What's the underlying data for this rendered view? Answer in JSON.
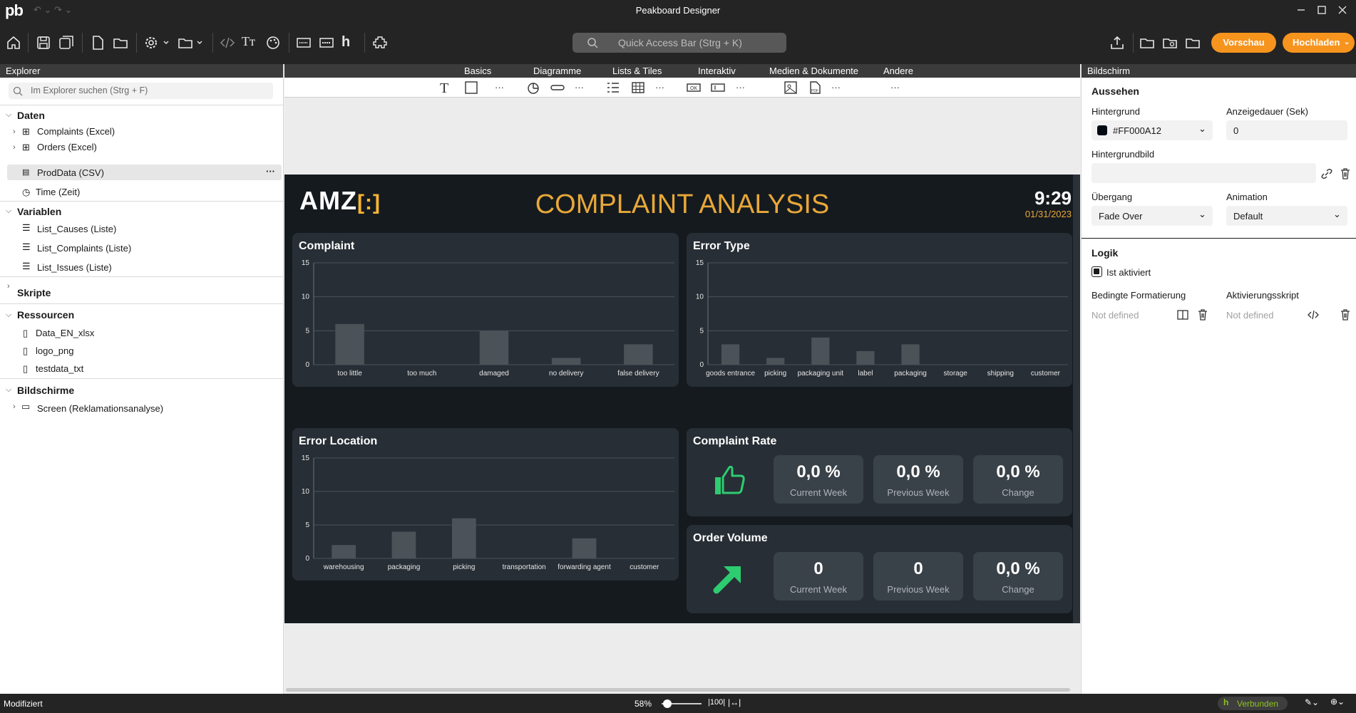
{
  "window": {
    "app_title": "Peakboard Designer",
    "logo": "pb"
  },
  "toolbar": {
    "quick_access_placeholder": "Quick Access Bar (Strg + K)",
    "preview_label": "Vorschau",
    "upload_label": "Hochladen"
  },
  "explorer": {
    "header": "Explorer",
    "search_placeholder": "Im Explorer suchen (Strg + F)",
    "sections": {
      "data": "Daten",
      "variables": "Variablen",
      "scripts": "Skripte",
      "resources": "Ressourcen",
      "screens": "Bildschirme"
    },
    "data_items": [
      "Complaints (Excel)",
      "Orders (Excel)",
      "ProdData (CSV)",
      "Time (Zeit)"
    ],
    "variable_items": [
      "List_Causes (Liste)",
      "List_Complaints (Liste)",
      "List_Issues (Liste)"
    ],
    "resource_items": [
      "Data_EN_xlsx",
      "logo_png",
      "testdata_txt"
    ],
    "screen_items": [
      "Screen (Reklamationsanalyse)"
    ]
  },
  "categories": [
    "Basics",
    "Diagramme",
    "Lists & Tiles",
    "Interaktiv",
    "Medien & Dokumente",
    "Andere"
  ],
  "dashboard": {
    "logo_text": "AMZ",
    "title": "COMPLAINT ANALYSIS",
    "time": "9:29",
    "date": "01/31/2023",
    "complaint_rate": {
      "title": "Complaint Rate",
      "current": {
        "value": "0,0 %",
        "label": "Current Week"
      },
      "previous": {
        "value": "0,0 %",
        "label": "Previous Week"
      },
      "change": {
        "value": "0,0 %",
        "label": "Change"
      }
    },
    "order_volume": {
      "title": "Order Volume",
      "current": {
        "value": "0",
        "label": "Current Week"
      },
      "previous": {
        "value": "0",
        "label": "Previous Week"
      },
      "change": {
        "value": "0,0 %",
        "label": "Change"
      }
    }
  },
  "chart_data": [
    {
      "type": "bar",
      "title": "Complaint",
      "categories": [
        "too little",
        "too much",
        "damaged",
        "no delivery",
        "false delivery"
      ],
      "values": [
        6,
        0,
        5,
        1,
        3
      ],
      "ylim": [
        0,
        15
      ],
      "yticks": [
        0,
        5,
        10,
        15
      ]
    },
    {
      "type": "bar",
      "title": "Error Type",
      "categories": [
        "goods entrance",
        "picking",
        "packaging unit",
        "label",
        "packaging",
        "storage",
        "shipping",
        "customer"
      ],
      "values": [
        3,
        1,
        4,
        2,
        3,
        0,
        0,
        0
      ],
      "ylim": [
        0,
        15
      ],
      "yticks": [
        0,
        5,
        10,
        15
      ]
    },
    {
      "type": "bar",
      "title": "Error Location",
      "categories": [
        "warehousing",
        "packaging",
        "picking",
        "transportation",
        "forwarding agent",
        "customer"
      ],
      "values": [
        2,
        4,
        6,
        0,
        3,
        0
      ],
      "ylim": [
        0,
        15
      ],
      "yticks": [
        0,
        5,
        10,
        15
      ]
    }
  ],
  "properties": {
    "header": "Bildschirm",
    "appearance": "Aussehen",
    "background_label": "Hintergrund",
    "background_value": "#FF000A12",
    "background_color": "#000A12",
    "duration_label": "Anzeigedauer (Sek)",
    "duration_value": "0",
    "bgimage_label": "Hintergrundbild",
    "transition_label": "Übergang",
    "transition_value": "Fade Over",
    "animation_label": "Animation",
    "animation_value": "Default",
    "logic": "Logik",
    "is_active_label": "Ist aktiviert",
    "conditional_label": "Bedingte Formatierung",
    "conditional_value": "Not defined",
    "activation_label": "Aktivierungsskript",
    "activation_value": "Not defined"
  },
  "status": {
    "modified": "Modifiziert",
    "zoom": "58%",
    "connected": "Verbunden"
  },
  "colors": {
    "accent": "#f7941d",
    "dashboard_title": "#e8a838",
    "kpi_green": "#2ecc71",
    "bar": "#4b5359"
  }
}
